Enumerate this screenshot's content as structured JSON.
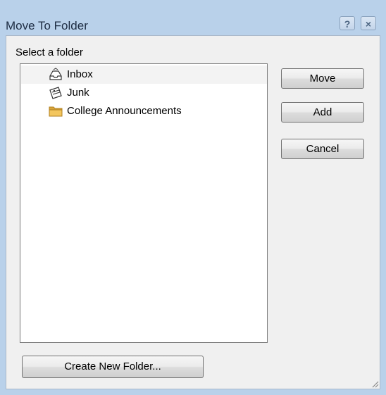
{
  "window": {
    "title": "Move To Folder",
    "help_label": "?",
    "close_label": "×"
  },
  "dialog": {
    "select_label": "Select a folder",
    "folders": [
      {
        "label": "Inbox",
        "icon": "inbox-icon",
        "selected": true
      },
      {
        "label": "Junk",
        "icon": "junk-icon",
        "selected": false
      },
      {
        "label": "College Announcements",
        "icon": "folder-icon",
        "selected": false
      }
    ]
  },
  "buttons": {
    "move": "Move",
    "add": "Add",
    "cancel": "Cancel",
    "create_new_folder": "Create New Folder..."
  },
  "colors": {
    "title_bar": "#b9d1ea",
    "dialog_background": "#f0f0f0",
    "folder_yellow": "#e8b444"
  }
}
